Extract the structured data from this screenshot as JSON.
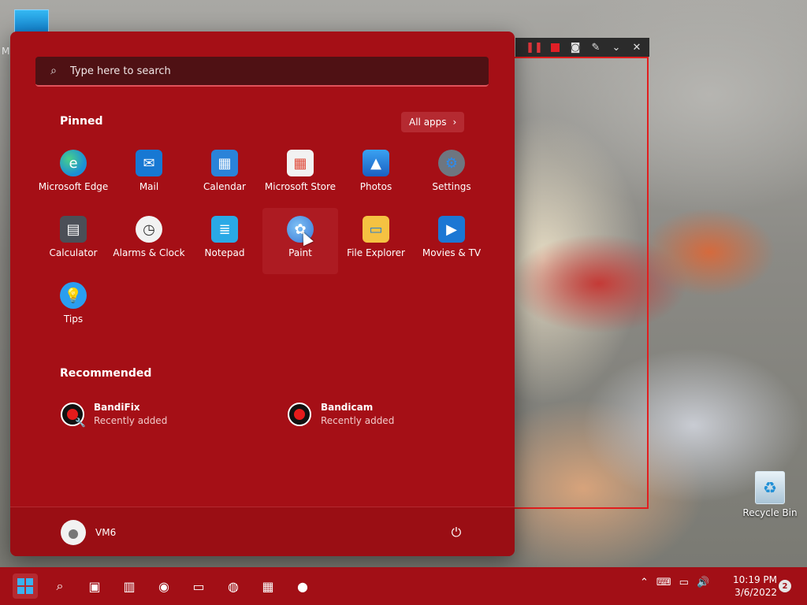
{
  "desktop": {
    "top_icon_label": "M",
    "recycle_bin_label": "Recycle Bin"
  },
  "recording_toolbar": {
    "icons": [
      "pause-icon",
      "stop-icon",
      "camera-icon",
      "pencil-icon",
      "collapse-icon",
      "close-icon"
    ]
  },
  "start_menu": {
    "search": {
      "placeholder": "Type here to search"
    },
    "pinned": {
      "title": "Pinned",
      "all_apps": "All apps",
      "apps": [
        {
          "label": "Microsoft Edge",
          "icon": "edge-icon",
          "color": "#1c8fd6"
        },
        {
          "label": "Mail",
          "icon": "mail-icon",
          "color": "#1778d3"
        },
        {
          "label": "Calendar",
          "icon": "calendar-icon",
          "color": "#2a83d9"
        },
        {
          "label": "Microsoft Store",
          "icon": "store-icon",
          "color": "#f2f2f2"
        },
        {
          "label": "Photos",
          "icon": "photos-icon",
          "color": "#2a7fe0"
        },
        {
          "label": "Settings",
          "icon": "settings-gear-icon",
          "color": "#6e7680"
        },
        {
          "label": "Calculator",
          "icon": "calculator-icon",
          "color": "#4b4f57"
        },
        {
          "label": "Alarms & Clock",
          "icon": "clock-icon",
          "color": "#f2f2f2"
        },
        {
          "label": "Notepad",
          "icon": "notepad-icon",
          "color": "#2aa9e6"
        },
        {
          "label": "Paint",
          "icon": "paint-icon",
          "color": "#5b9be8"
        },
        {
          "label": "File Explorer",
          "icon": "folder-icon",
          "color": "#f5c242"
        },
        {
          "label": "Movies & TV",
          "icon": "movies-icon",
          "color": "#1c77d4"
        },
        {
          "label": "Tips",
          "icon": "tips-icon",
          "color": "#2a9ef0"
        }
      ]
    },
    "recommended": {
      "title": "Recommended",
      "items": [
        {
          "name": "BandiFix",
          "subtitle": "Recently added"
        },
        {
          "name": "Bandicam",
          "subtitle": "Recently added"
        }
      ]
    },
    "user": {
      "name": "VM6"
    }
  },
  "taskbar": {
    "clock_time": "10:19 PM",
    "clock_date": "3/6/2022",
    "notification_count": "2"
  }
}
